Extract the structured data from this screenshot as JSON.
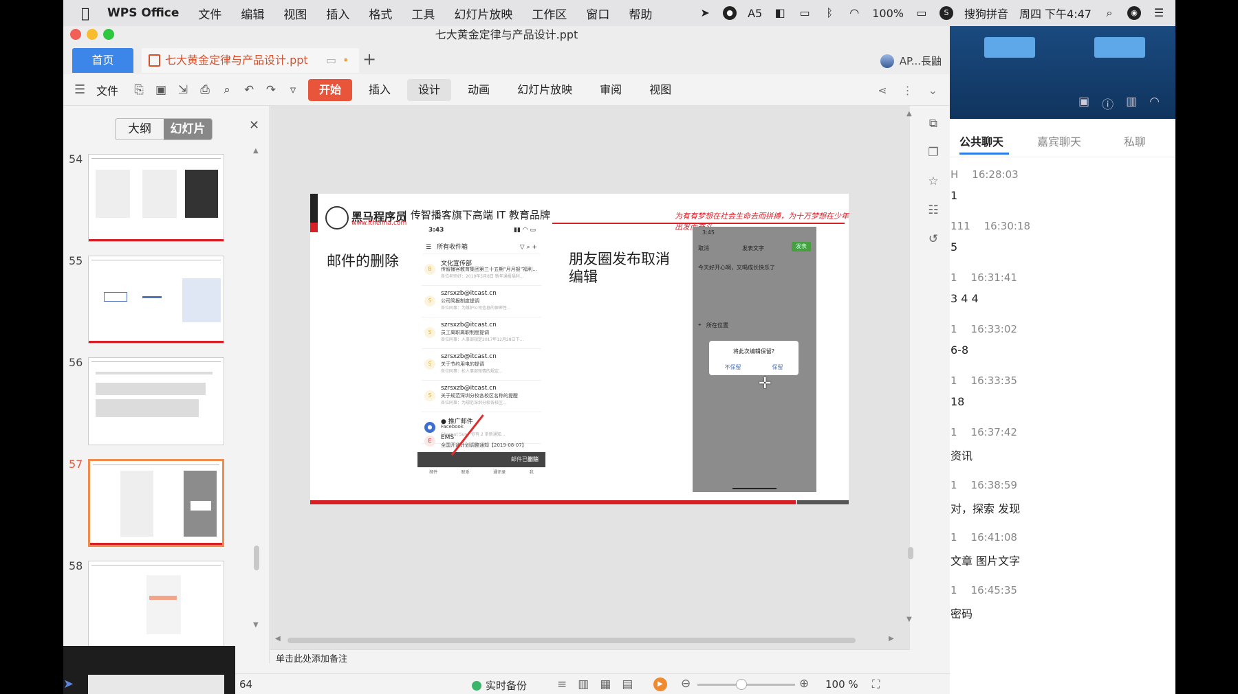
{
  "menubar": {
    "app": "WPS Office",
    "items": [
      "文件",
      "编辑",
      "视图",
      "插入",
      "格式",
      "工具",
      "幻灯片放映",
      "工作区",
      "窗口",
      "帮助"
    ],
    "badge_num": "5",
    "battery": "100%",
    "ime": "搜狗拼音",
    "clock": "周四 下午4:47"
  },
  "window": {
    "title": "七大黄金定律与产品设计.ppt",
    "home_tab": "首页",
    "doc_tab": "七大黄金定律与产品设计.ppt",
    "plus": "+",
    "user": "AP...長鼬"
  },
  "toolbar": {
    "file": "文件",
    "tabs": [
      "开始",
      "插入",
      "设计",
      "动画",
      "幻灯片放映",
      "审阅",
      "视图"
    ]
  },
  "panel": {
    "outline": "大纲",
    "slides": "幻灯片",
    "thumbs": [
      {
        "num": "54"
      },
      {
        "num": "55"
      },
      {
        "num": "56"
      },
      {
        "num": "57"
      },
      {
        "num": "58"
      }
    ]
  },
  "slide": {
    "brand": "黑马程序员",
    "brand_url": "www.itheima.com",
    "tagline": "| 传智播客旗下高端 IT 教育品牌",
    "slogan": "为有有梦想在社会生命去而拼搏，为十万梦想在少年出发而奋斗",
    "heading_left": "邮件的删除",
    "heading_right": "朋友圈发布取消编辑",
    "phone1": {
      "time": "3:43",
      "header": "所有收件箱",
      "mails": [
        {
          "from": "文化宣传部",
          "subj": "传智播客教育集团第三十五期“月月报”福利...",
          "prev": "各位老师好：2019年5月8日 新年通报福利...",
          "icon": "B"
        },
        {
          "from": "szrsxzb@itcast.cn",
          "subj": "公司简报制度提调",
          "prev": "各位同事：为维护公司信息的保密性...",
          "icon": "S"
        },
        {
          "from": "szrsxzb@itcast.cn",
          "subj": "员工离职离职制度提调",
          "prev": "各位同事：人事部规定2017年12月28日下...",
          "icon": "S"
        },
        {
          "from": "szrsxzb@itcast.cn",
          "subj": "关于节约用电的提调",
          "prev": "各位同事：松人事部知情的规定...",
          "icon": "S"
        },
        {
          "from": "szrsxzb@itcast.cn",
          "subj": "关于规范深圳分校各校区名称的提醒",
          "prev": "各位同事：为规范深圳分校各校区...",
          "icon": "S"
        },
        {
          "from": "● 推广邮件",
          "subj": "Facebook",
          "prev": "Chesnut Sun，你有 2 条新通知...",
          "icon": "●"
        },
        {
          "from": "EMS",
          "subj": "全国开通计划调整通知【2019-08-07】",
          "prev": "",
          "icon": "E"
        }
      ],
      "toast": "邮件已删除",
      "undo": "撤销",
      "nav": [
        "邮件",
        "联系",
        "通讯录",
        "我"
      ]
    },
    "phone2": {
      "time": "3:45",
      "cancel": "取消",
      "title": "发表文字",
      "publish": "发表",
      "text": "今天好开心啊，又喝成长快乐了",
      "location": "所在位置",
      "dialog_q": "将此次编辑保留?",
      "dialog_no": "不保留",
      "dialog_yes": "保留"
    }
  },
  "notes": "单击此处添加备注",
  "status": {
    "slide_count": "64",
    "backup": "实时备份",
    "zoom": "100 %"
  },
  "chat": {
    "tabs": [
      "公共聊天",
      "嘉宾聊天",
      "私聊"
    ],
    "messages": [
      {
        "who": "H",
        "time": "16:28:03",
        "text": "1"
      },
      {
        "who": "111",
        "time": "16:30:18",
        "text": "5"
      },
      {
        "who": "1",
        "time": "16:31:41",
        "text": "3 4 4"
      },
      {
        "who": "1",
        "time": "16:33:02",
        "text": "6-8"
      },
      {
        "who": "1",
        "time": "16:33:35",
        "text": "18"
      },
      {
        "who": "1",
        "time": "16:37:42",
        "text": "资讯"
      },
      {
        "who": "1",
        "time": "16:38:59",
        "text": "对，探索 发现"
      },
      {
        "who": "1",
        "time": "16:41:08",
        "text": "文章 图片文字"
      },
      {
        "who": "1",
        "time": "16:45:35",
        "text": "密码"
      }
    ]
  },
  "colors": {
    "accent_orange": "#e8553b",
    "brand_red": "#d91f26",
    "home_blue": "#3b86e8",
    "chat_blue": "#2f7be8"
  }
}
